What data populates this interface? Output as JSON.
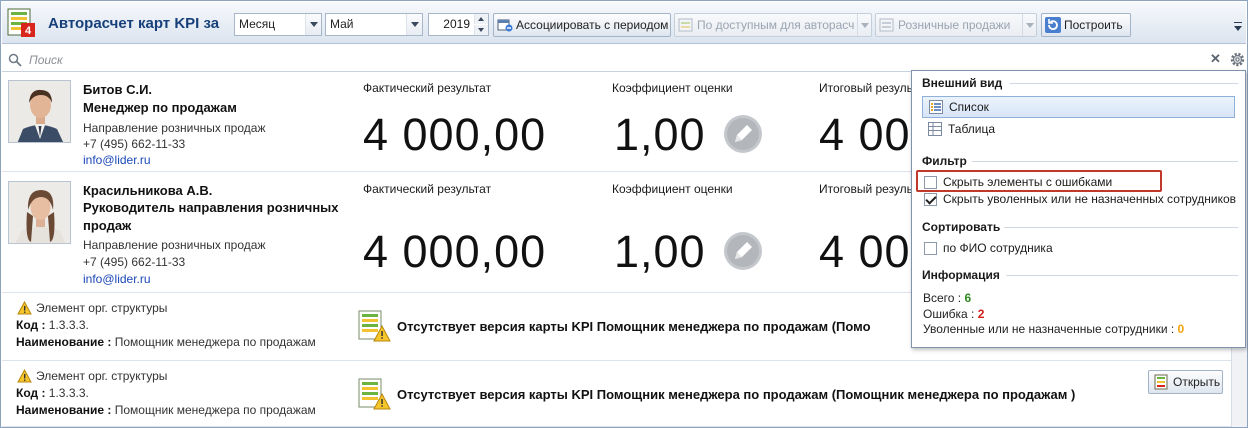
{
  "toolbar": {
    "title": "Авторасчет карт KPI за",
    "app_badge": "4",
    "period_type": "Месяц",
    "month": "Май",
    "year": "2019",
    "associate_label": "Ассоциировать с периодом",
    "filter_label": "По доступным для авторасч",
    "group_label": "Розничные продажи",
    "build_label": "Построить"
  },
  "search": {
    "placeholder": "Поиск"
  },
  "metrics_labels": {
    "fact": "Фактический результат",
    "coef": "Коэффициент оценки",
    "total": "Итоговый резуль"
  },
  "employees": [
    {
      "name": "Битов С.И.",
      "position": "Менеджер по продажам",
      "department": "Направление розничных продаж",
      "phone": "+7 (495) 662-11-33",
      "email": "info@lider.ru",
      "fact": "4 000,00",
      "coef": "1,00",
      "total": "4 00"
    },
    {
      "name": "Красильникова А.В.",
      "position": "Руководитель направления розничных продаж",
      "department": "Направление розничных продаж",
      "phone": "+7 (495) 662-11-33",
      "email": "info@lider.ru",
      "fact": "4 000,00",
      "coef": "1,00",
      "total": "4 00"
    }
  ],
  "org_items": [
    {
      "type_label": "Элемент орг. структуры",
      "code_label": "Код :",
      "code": "1.3.3.3.",
      "name_label": "Наименование :",
      "name": "Помощник менеджера по продажам",
      "message": "Отсутствует версия карты KPI Помощник менеджера по продажам  (Помо"
    },
    {
      "type_label": "Элемент орг. структуры",
      "code_label": "Код :",
      "code": "1.3.3.3.",
      "name_label": "Наименование :",
      "name": "Помощник менеджера по продажам",
      "message": "Отсутствует версия карты KPI Помощник менеджера по продажам  (Помощник менеджера по продажам )",
      "open_label": "Открыть"
    }
  ],
  "panel": {
    "view_title": "Внешний вид",
    "view_list": "Список",
    "view_table": "Таблица",
    "filter_title": "Фильтр",
    "hide_errors": "Скрыть элементы с ошибками",
    "hide_errors_checked": false,
    "hide_fired": "Скрыть уволенных или не назначенных сотрудников",
    "hide_fired_checked": true,
    "sort_title": "Сортировать",
    "sort_fio": "по ФИО сотрудника",
    "sort_fio_checked": false,
    "info_title": "Информация",
    "total_label": "Всего :",
    "total": "6",
    "error_label": "Ошибка :",
    "errors": "2",
    "fired_label": "Уволенные или не назначенные сотрудники :",
    "fired": "0"
  },
  "colors": {
    "accent": "#17407a",
    "highlight": "#c0392b",
    "ok": "#2e8b1f",
    "error": "#d0221b",
    "warn": "#f0a30a"
  }
}
